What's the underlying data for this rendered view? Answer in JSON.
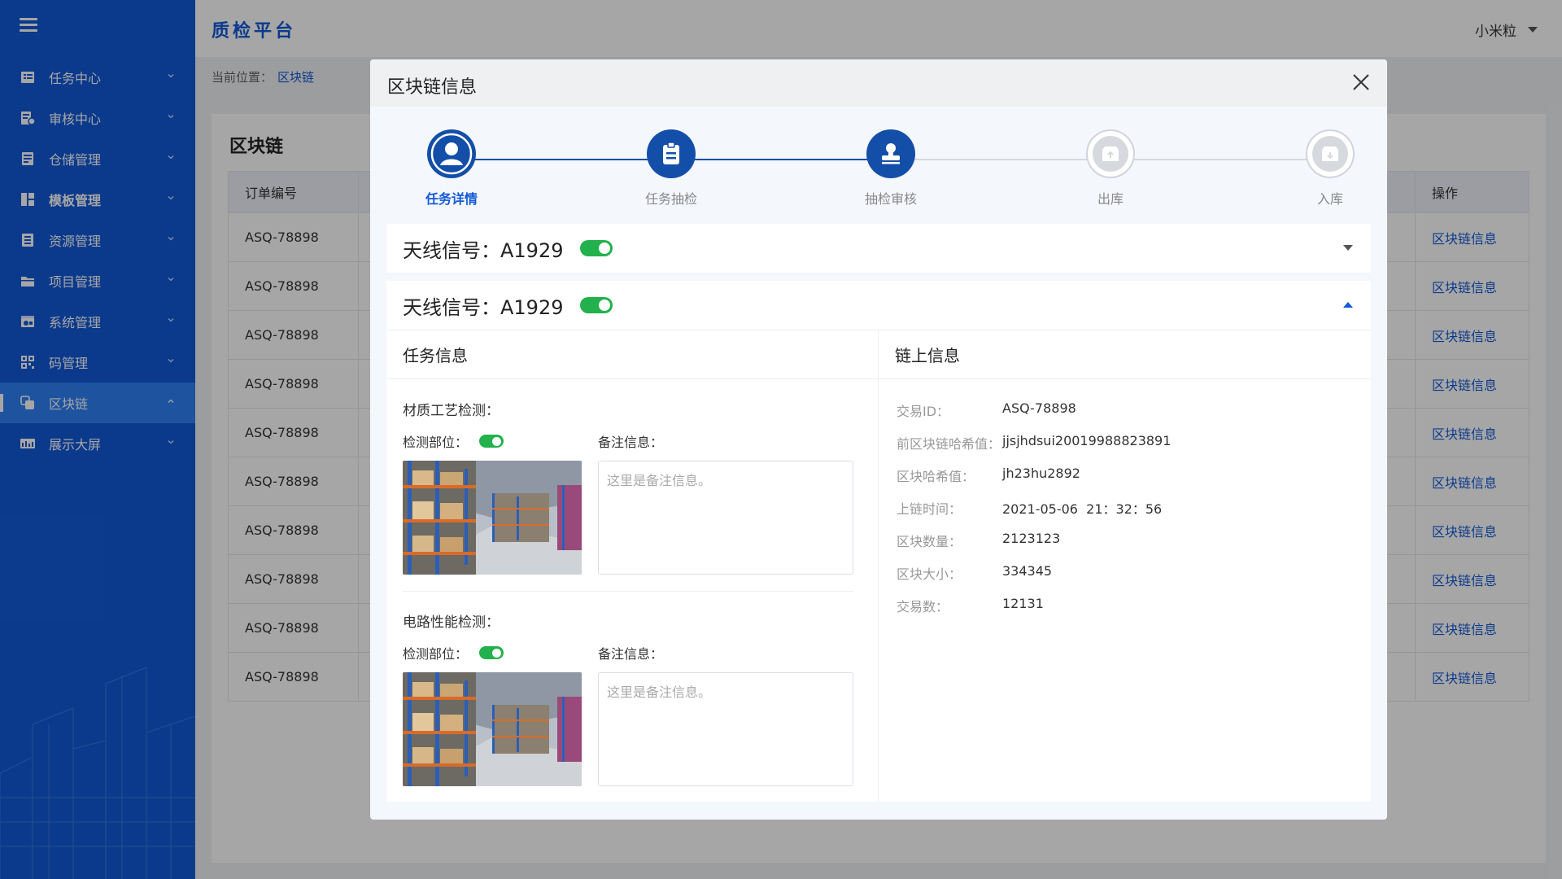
{
  "sidebar": {
    "items": [
      {
        "label": "任务中心",
        "icon": "task-center-icon"
      },
      {
        "label": "审核中心",
        "icon": "review-center-icon"
      },
      {
        "label": "仓储管理",
        "icon": "storage-icon"
      },
      {
        "label": "模板管理",
        "icon": "template-icon"
      },
      {
        "label": "资源管理",
        "icon": "resource-icon"
      },
      {
        "label": "项目管理",
        "icon": "folder-icon"
      },
      {
        "label": "系统管理",
        "icon": "system-icon"
      },
      {
        "label": "码管理",
        "icon": "qrcode-icon"
      },
      {
        "label": "区块链",
        "icon": "blockchain-icon"
      },
      {
        "label": "展示大屏",
        "icon": "screen-icon"
      }
    ]
  },
  "header": {
    "title": "质检平台",
    "user": "小米粒"
  },
  "breadcrumb": {
    "prefix": "当前位置：",
    "current": "区块链"
  },
  "page": {
    "title": "区块链"
  },
  "table": {
    "col_order": "订单编号",
    "col_action": "操作",
    "rows": [
      {
        "id": "ASQ-78898",
        "action": "区块链信息"
      },
      {
        "id": "ASQ-78898",
        "action": "区块链信息"
      },
      {
        "id": "ASQ-78898",
        "action": "区块链信息"
      },
      {
        "id": "ASQ-78898",
        "action": "区块链信息"
      },
      {
        "id": "ASQ-78898",
        "action": "区块链信息"
      },
      {
        "id": "ASQ-78898",
        "action": "区块链信息"
      },
      {
        "id": "ASQ-78898",
        "action": "区块链信息"
      },
      {
        "id": "ASQ-78898",
        "action": "区块链信息"
      },
      {
        "id": "ASQ-78898",
        "action": "区块链信息"
      },
      {
        "id": "ASQ-78898",
        "action": "区块链信息"
      }
    ]
  },
  "modal": {
    "title": "区块链信息",
    "steps": [
      {
        "label": "任务详情",
        "icon": "user-icon"
      },
      {
        "label": "任务抽检",
        "icon": "clipboard-icon"
      },
      {
        "label": "抽检审核",
        "icon": "stamp-icon"
      },
      {
        "label": "出库",
        "icon": "box-out-icon"
      },
      {
        "label": "入库",
        "icon": "box-in-icon"
      }
    ],
    "panel1": {
      "title": "天线信号：A1929"
    },
    "panel2": {
      "title": "天线信号：A1929",
      "task_info_title": "任务信息",
      "chain_info_title": "链上信息",
      "groups": [
        {
          "title": "材质工艺检测：",
          "part_label": "检测部位：",
          "note_label": "备注信息：",
          "note_placeholder": "这里是备注信息。"
        },
        {
          "title": "电路性能检测：",
          "part_label": "检测部位：",
          "note_label": "备注信息：",
          "note_placeholder": "这里是备注信息。"
        }
      ],
      "chain": [
        {
          "k": "交易ID：",
          "v": "ASQ-78898"
        },
        {
          "k": "前区块链哈希值：",
          "v": "jjsjhdsui20019988823891"
        },
        {
          "k": "区块哈希值：",
          "v": "jh23hu2892"
        },
        {
          "k": "上链时间：",
          "v": "2021-05-06  21：32：56"
        },
        {
          "k": "区块数量：",
          "v": "2123123"
        },
        {
          "k": "区块大小：",
          "v": "334345"
        },
        {
          "k": "交易数：",
          "v": "12131"
        }
      ]
    }
  },
  "colors": {
    "primary": "#1259d8",
    "step_active": "#134fa8",
    "toggle_on": "#22b14c"
  }
}
